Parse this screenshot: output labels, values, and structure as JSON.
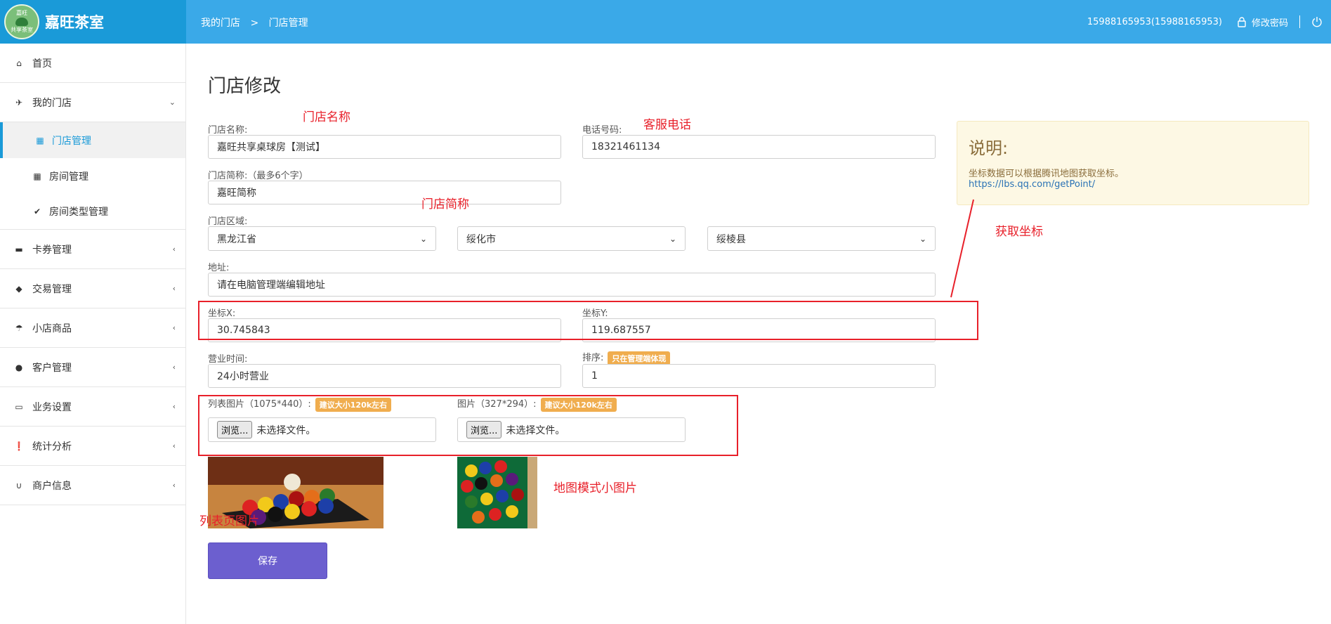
{
  "header": {
    "brand_name": "嘉旺茶室",
    "logo_text_top": "嘉旺",
    "logo_text_bottom": "共享茶室",
    "breadcrumb": [
      "我的门店",
      ">",
      "门店管理"
    ],
    "user": "15988165953(15988165953)",
    "change_password": "修改密码",
    "bg_color": "#3aa9e8"
  },
  "sidebar": {
    "items": [
      {
        "label": "首页",
        "icon": "home-icon"
      },
      {
        "label": "我的门店",
        "icon": "plane-icon",
        "arrow": "⌄"
      },
      {
        "label": "门店管理",
        "icon": "grid-icon",
        "sub": true,
        "active": true
      },
      {
        "label": "房间管理",
        "icon": "grid-icon",
        "sub": true
      },
      {
        "label": "房间类型管理",
        "icon": "check-icon",
        "sub": true
      },
      {
        "label": "卡券管理",
        "icon": "folder-icon",
        "arrow": "‹"
      },
      {
        "label": "交易管理",
        "icon": "tags-icon",
        "arrow": "‹"
      },
      {
        "label": "小店商品",
        "icon": "umbrella-icon",
        "arrow": "‹"
      },
      {
        "label": "客户管理",
        "icon": "user-icon",
        "arrow": "‹"
      },
      {
        "label": "业务设置",
        "icon": "inbox-icon",
        "arrow": "‹"
      },
      {
        "label": "统计分析",
        "icon": "info-icon",
        "arrow": "‹"
      },
      {
        "label": "商户信息",
        "icon": "magnet-icon",
        "arrow": "‹"
      }
    ]
  },
  "form": {
    "title": "门店修改",
    "store_name_label": "门店名称:",
    "store_name_value": "嘉旺共享桌球房【测试】",
    "phone_label": "电话号码:",
    "phone_value": "18321461134",
    "short_name_label": "门店简称:（最多6个字）",
    "short_name_value": "嘉旺简称",
    "region_label": "门店区域:",
    "province": "黑龙江省",
    "city": "绥化市",
    "county": "绥棱县",
    "address_label": "地址:",
    "address_value": "请在电脑管理端编辑地址",
    "coord_x_label": "坐标X:",
    "coord_x_value": "30.745843",
    "coord_y_label": "坐标Y:",
    "coord_y_value": "119.687557",
    "hours_label": "营业时间:",
    "hours_value": "24小时营业",
    "sort_label": "排序:",
    "sort_badge": "只在管理端体现",
    "sort_value": "1",
    "list_image_label": "列表图片（1075*440）:",
    "list_image_badge": "建议大小120k左右",
    "image_label": "图片（327*294）:",
    "image_badge": "建议大小120k左右",
    "browse_label": "浏览...",
    "no_file_label": "未选择文件。",
    "save_label": "保存"
  },
  "note": {
    "heading": "说明:",
    "text": "坐标数据可以根据腾讯地图获取坐标。",
    "link": "https://lbs.qq.com/getPoint/"
  },
  "annotations": {
    "store_name": "门店名称",
    "service_phone": "客服电话",
    "short_name": "门店简称",
    "get_coords": "获取坐标",
    "map_small_image": "地图模式小图片",
    "list_page_image": "列表页图片"
  }
}
